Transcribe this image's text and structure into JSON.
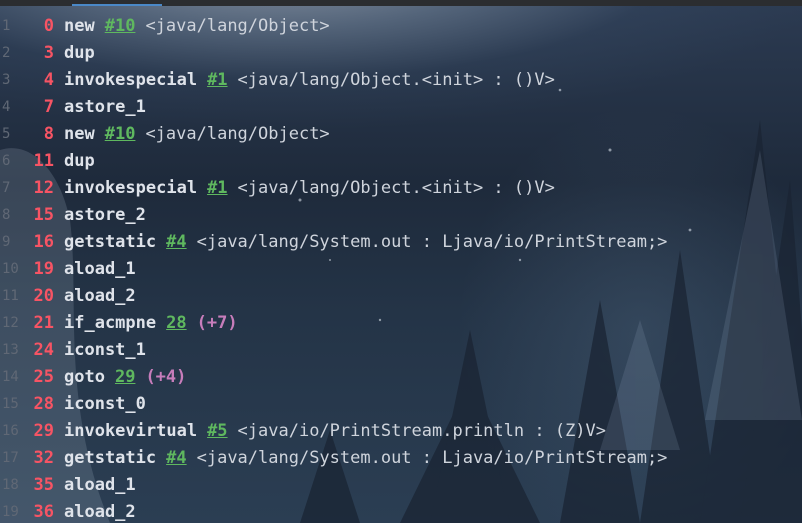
{
  "colors": {
    "offset": "#f75464",
    "opcode": "#dfe3ea",
    "reference": "#5fb85f",
    "comment": "#cfd4dc",
    "relative": "#c77dbb",
    "line_number": "#606875",
    "tab_indicator": "#4a88c7"
  },
  "lines": [
    {
      "num": "1",
      "offset": "0",
      "op": "new",
      "ref": "#10",
      "comment": "<java/lang/Object>",
      "rel": ""
    },
    {
      "num": "2",
      "offset": "3",
      "op": "dup",
      "ref": "",
      "comment": "",
      "rel": ""
    },
    {
      "num": "3",
      "offset": "4",
      "op": "invokespecial",
      "ref": "#1",
      "comment": "<java/lang/Object.<init> : ()V>",
      "rel": ""
    },
    {
      "num": "4",
      "offset": "7",
      "op": "astore_1",
      "ref": "",
      "comment": "",
      "rel": ""
    },
    {
      "num": "5",
      "offset": "8",
      "op": "new",
      "ref": "#10",
      "comment": "<java/lang/Object>",
      "rel": ""
    },
    {
      "num": "6",
      "offset": "11",
      "op": "dup",
      "ref": "",
      "comment": "",
      "rel": ""
    },
    {
      "num": "7",
      "offset": "12",
      "op": "invokespecial",
      "ref": "#1",
      "comment": "<java/lang/Object.<init> : ()V>",
      "rel": ""
    },
    {
      "num": "8",
      "offset": "15",
      "op": "astore_2",
      "ref": "",
      "comment": "",
      "rel": ""
    },
    {
      "num": "9",
      "offset": "16",
      "op": "getstatic",
      "ref": "#4",
      "comment": "<java/lang/System.out : Ljava/io/PrintStream;>",
      "rel": ""
    },
    {
      "num": "10",
      "offset": "19",
      "op": "aload_1",
      "ref": "",
      "comment": "",
      "rel": ""
    },
    {
      "num": "11",
      "offset": "20",
      "op": "aload_2",
      "ref": "",
      "comment": "",
      "rel": ""
    },
    {
      "num": "12",
      "offset": "21",
      "op": "if_acmpne",
      "ref": "28",
      "comment": "",
      "rel": "(+7)"
    },
    {
      "num": "13",
      "offset": "24",
      "op": "iconst_1",
      "ref": "",
      "comment": "",
      "rel": ""
    },
    {
      "num": "14",
      "offset": "25",
      "op": "goto",
      "ref": "29",
      "comment": "",
      "rel": "(+4)"
    },
    {
      "num": "15",
      "offset": "28",
      "op": "iconst_0",
      "ref": "",
      "comment": "",
      "rel": ""
    },
    {
      "num": "16",
      "offset": "29",
      "op": "invokevirtual",
      "ref": "#5",
      "comment": "<java/io/PrintStream.println : (Z)V>",
      "rel": ""
    },
    {
      "num": "17",
      "offset": "32",
      "op": "getstatic",
      "ref": "#4",
      "comment": "<java/lang/System.out : Ljava/io/PrintStream;>",
      "rel": ""
    },
    {
      "num": "18",
      "offset": "35",
      "op": "aload_1",
      "ref": "",
      "comment": "",
      "rel": ""
    },
    {
      "num": "19",
      "offset": "36",
      "op": "aload_2",
      "ref": "",
      "comment": "",
      "rel": ""
    }
  ]
}
